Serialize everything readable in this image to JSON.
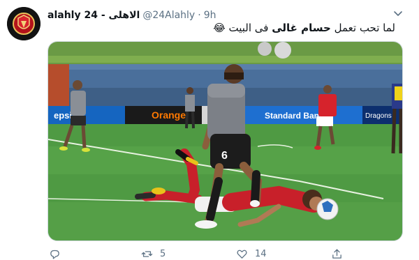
{
  "tweet": {
    "display_name": "alahly 24 - الاهلى",
    "handle": "@24Alahly",
    "separator": "·",
    "time": "9h",
    "text_before": "لما تحب تعمل ",
    "text_bold": "حسام غالى",
    "text_after": " فى البيت 😂"
  },
  "media": {
    "ad_boards": [
      "epsi",
      "Orange",
      "Standard Bank",
      "Dragons"
    ],
    "player_number": "6"
  },
  "actions": {
    "reply_count": "",
    "retweet_count": "5",
    "like_count": "14"
  },
  "icons": [
    "club-logo-icon",
    "caret-down-icon",
    "reply-icon",
    "retweet-icon",
    "like-icon",
    "share-icon"
  ],
  "colors": {
    "secondary_text": "#5b7083",
    "pitch": "#4f9a43",
    "ahly_red": "#c8202a"
  }
}
